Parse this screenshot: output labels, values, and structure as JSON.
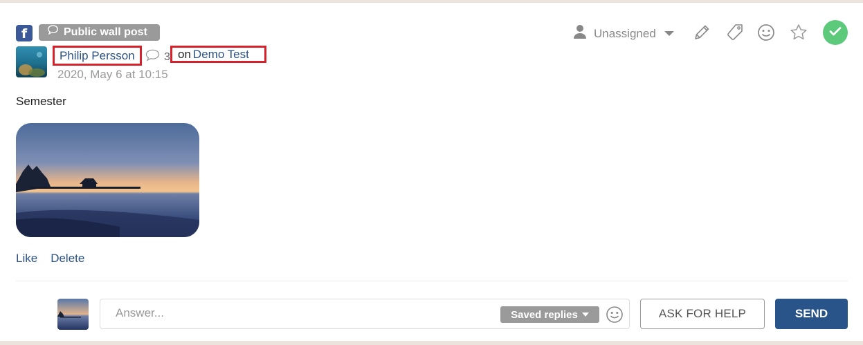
{
  "post": {
    "network_icon": "facebook-icon",
    "type_label": "Public wall post",
    "author": "Philip Persson",
    "comment_count": "3",
    "on_label": "on",
    "page_name": "Demo Test",
    "timestamp": "2020, May 6 at 10:15",
    "text": "Semester"
  },
  "toolbar": {
    "assignee": "Unassigned",
    "icons": [
      "user-icon",
      "chevron-down-icon",
      "pencil-icon",
      "tag-icon",
      "smiley-icon",
      "star-icon",
      "check-icon"
    ]
  },
  "actions": {
    "like": "Like",
    "delete": "Delete"
  },
  "reply": {
    "placeholder": "Answer...",
    "saved_replies": "Saved replies",
    "ask_for_help": "ASK FOR HELP",
    "send": "SEND"
  },
  "colors": {
    "facebook": "#3b5998",
    "link": "#2b5183",
    "highlight_border": "#d6202a",
    "resolve_green": "#5cc97b",
    "send_blue": "#28548a",
    "pill_gray": "#9a9a9a"
  }
}
